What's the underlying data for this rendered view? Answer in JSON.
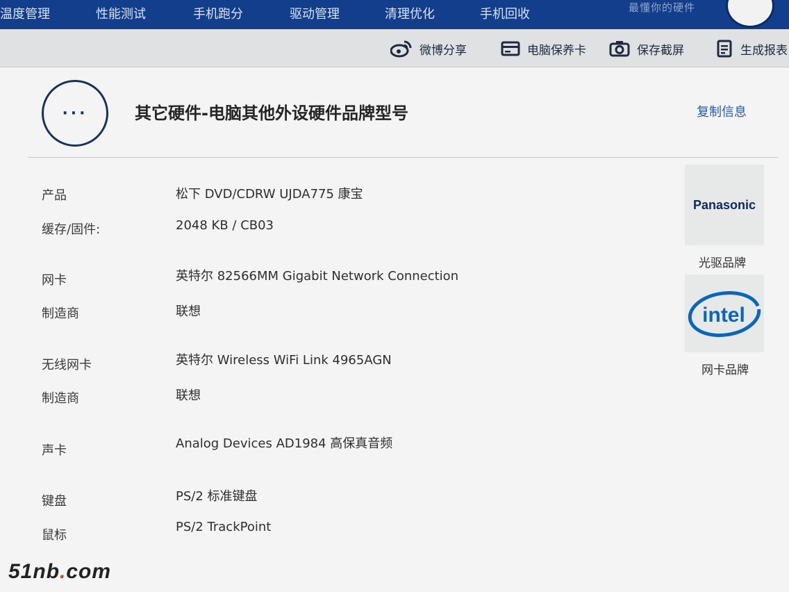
{
  "nav": {
    "items": [
      "温度管理",
      "性能测试",
      "手机跑分",
      "驱动管理",
      "清理优化",
      "手机回收"
    ],
    "slogan": "最懂你的硬件"
  },
  "toolbar": {
    "weibo_share": "微博分享",
    "pc_warranty_card": "电脑保养卡",
    "save_screenshot": "保存截屏",
    "generate_report": "生成报表"
  },
  "header": {
    "icon_text": "···",
    "title": "其它硬件-电脑其他外设硬件品牌型号",
    "copy_info": "复制信息"
  },
  "specs": [
    {
      "label": "产品",
      "value": "松下 DVD/CDRW UJDA775 康宝"
    },
    {
      "label": "缓存/固件:",
      "value": "2048 KB / CB03"
    },
    {
      "label": "网卡",
      "value": "英特尔 82566MM Gigabit Network Connection"
    },
    {
      "label": "制造商",
      "value": "联想"
    },
    {
      "label": "无线网卡",
      "value": "英特尔 Wireless WiFi Link 4965AGN"
    },
    {
      "label": "制造商",
      "value": "联想"
    },
    {
      "label": "声卡",
      "value": "Analog Devices AD1984 高保真音频"
    },
    {
      "label": "键盘",
      "value": "PS/2 标准键盘"
    },
    {
      "label": "鼠标",
      "value": "PS/2 TrackPoint"
    }
  ],
  "brands": {
    "optical": {
      "logo_text": "Panasonic",
      "caption": "光驱品牌"
    },
    "network": {
      "logo_text": "intel",
      "caption": "网卡品牌"
    }
  },
  "watermark": {
    "main": "51nb",
    "dot": ".",
    "suffix": "com"
  },
  "colors": {
    "nav_bg": "#123e8c",
    "link": "#2a5aa8",
    "panasonic": "#0d2a5c",
    "intel": "#0a66b8"
  }
}
